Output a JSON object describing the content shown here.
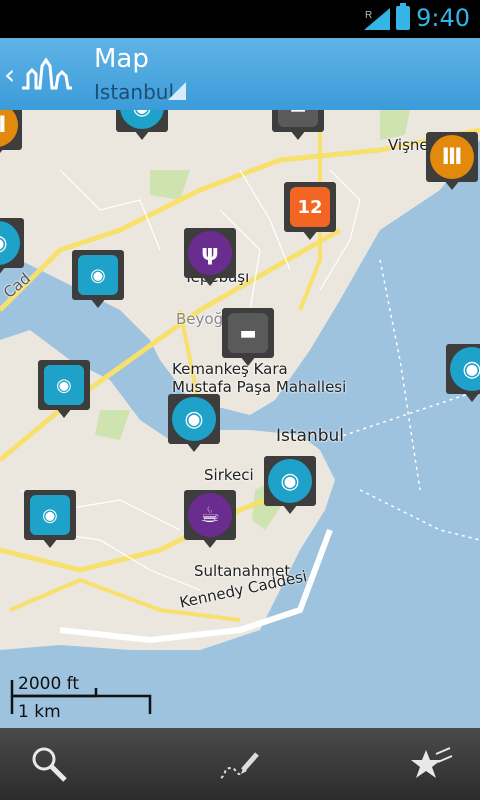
{
  "status_bar": {
    "time": "9:40",
    "roaming": "R"
  },
  "action_bar": {
    "title": "Map",
    "subtitle": "Istanbul"
  },
  "map_labels": {
    "visne": "Vişne",
    "tepebasi": "Tepebaşı",
    "beyoglu": "Beyoğ",
    "kemankes": "Kemankeş Kara",
    "mustafa": "Mustafa Paşa Mahallesi",
    "istanbul": "Istanbul",
    "sirkeci": "Sirkeci",
    "sultanahmet": "Sultanahmet",
    "kennedy": "Kennedy Caddesi",
    "cad": "Cad"
  },
  "calendar_day": "12",
  "scale": {
    "feet": "2000 ft",
    "km": "1 km"
  },
  "colors": {
    "accent": "#33b5e5",
    "sight": "#1fa2c9",
    "museum": "#e38a0c",
    "food": "#6a2d8f",
    "event": "#f26522",
    "hotel": "#5a5a5a"
  },
  "icons": [
    "back-icon",
    "city-logo-icon",
    "search-icon",
    "itinerary-icon",
    "favorites-icon",
    "camera-icon",
    "museum-icon",
    "restaurant-icon",
    "calendar-icon",
    "hotel-icon",
    "cafe-icon"
  ]
}
